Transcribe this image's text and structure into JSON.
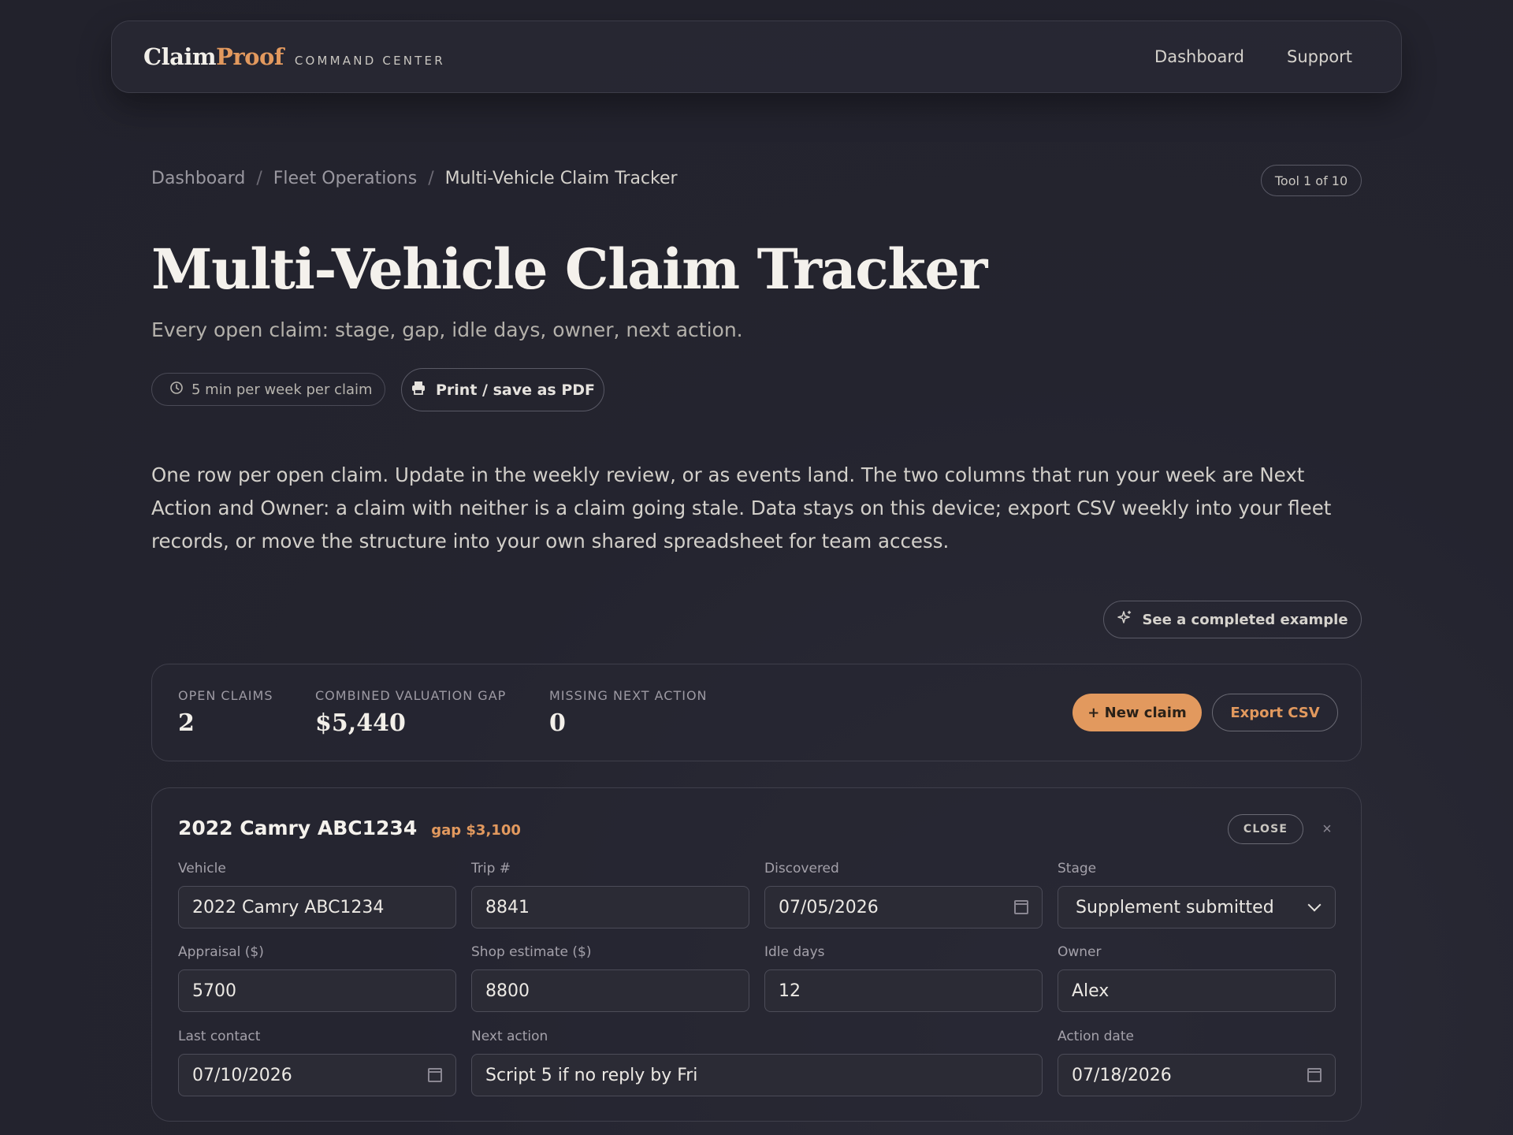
{
  "brand": {
    "name_part1": "Claim",
    "name_part2": "Proof",
    "subtitle": "COMMAND CENTER"
  },
  "topnav": {
    "dashboard": "Dashboard",
    "support": "Support"
  },
  "breadcrumb": {
    "items": [
      "Dashboard",
      "Fleet Operations",
      "Multi-Vehicle Claim Tracker"
    ],
    "separator": "/"
  },
  "tool_badge": "Tool 1 of 10",
  "page": {
    "title": "Multi-Vehicle Claim Tracker",
    "subtitle": "Every open claim: stage, gap, idle days, owner, next action.",
    "time_pill": "5 min per week per claim",
    "print_button": "Print / save as PDF",
    "intro": "One row per open claim. Update in the weekly review, or as events land. The two columns that run your week are Next Action and Owner: a claim with neither is a claim going stale. Data stays on this device; export CSV weekly into your fleet records, or move the structure into your own shared spreadsheet for team access.",
    "example_button": "See a completed example"
  },
  "summary": {
    "open_claims_label": "OPEN CLAIMS",
    "open_claims_value": "2",
    "gap_label": "COMBINED VALUATION GAP",
    "gap_value": "$5,440",
    "missing_label": "MISSING NEXT ACTION",
    "missing_value": "0",
    "new_claim_button": "+ New claim",
    "export_button": "Export CSV"
  },
  "claim": {
    "title": "2022 Camry ABC1234",
    "gap": "gap $3,100",
    "close_button": "CLOSE",
    "remove_button": "×",
    "fields": {
      "vehicle": {
        "label": "Vehicle",
        "value": "2022 Camry ABC1234"
      },
      "trip": {
        "label": "Trip #",
        "value": "8841"
      },
      "discovered": {
        "label": "Discovered",
        "value": "07/05/2026"
      },
      "stage": {
        "label": "Stage",
        "value": "Supplement submitted"
      },
      "appraisal": {
        "label": "Appraisal ($)",
        "value": "5700"
      },
      "shop_estimate": {
        "label": "Shop estimate ($)",
        "value": "8800"
      },
      "idle_days": {
        "label": "Idle days",
        "value": "12"
      },
      "owner": {
        "label": "Owner",
        "value": "Alex"
      },
      "last_contact": {
        "label": "Last contact",
        "value": "07/10/2026"
      },
      "next_action": {
        "label": "Next action",
        "value": "Script 5 if no reply by Fri"
      },
      "action_date": {
        "label": "Action date",
        "value": "07/18/2026"
      }
    }
  },
  "colors": {
    "accent": "#e2995e",
    "background": "#24242f",
    "text": "#e6e3de"
  },
  "icons": {
    "time": "clock-icon",
    "print": "printer-icon",
    "example": "sparkle-icon",
    "date": "calendar-icon",
    "select": "chevron-down-icon"
  }
}
